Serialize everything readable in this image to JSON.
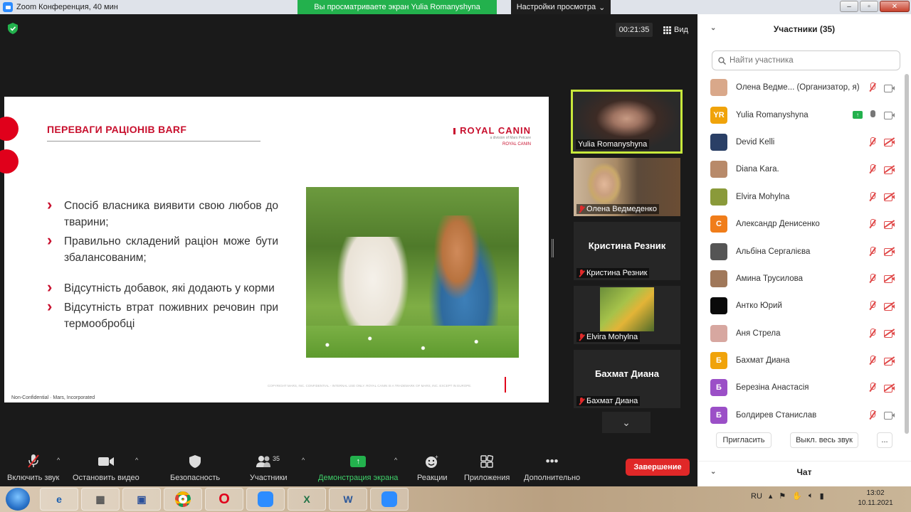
{
  "window": {
    "title": "Zoom Конференция, 40 мин",
    "share_banner": "Вы просматриваете экран Yulia Romanyshyna",
    "view_options": "Настройки просмотра"
  },
  "meeting": {
    "timer": "00:21:35",
    "view_label": "Вид"
  },
  "slide": {
    "title": "ПЕРЕВАГИ РАЦІОНІВ BARF",
    "logo_brand": "ROYAL CANIN",
    "logo_sub": "a division of Mars Petcare",
    "logo_crown": "ROYAL CANIN",
    "bullets": [
      "Спосіб власника виявити свою любов до тварини;",
      "Правильно складений раціон може бути збалансованим;",
      "Відсутність добавок, які додають у корми",
      "Відсутність втрат поживних речовин при термообробці"
    ],
    "copyright": "COPYRIGHT MARS, INC. CONFIDENTIAL - INTERNAL USE ONLY. ROYAL CANIN IS A TRADEMARK OF MARS, INC. EXCEPT IN EUROPE.",
    "footer": "Non-Confidential · Mars, Incorporated"
  },
  "gallery": [
    {
      "name": "Yulia Romanyshyna"
    },
    {
      "name": "Олена Ведмеденко"
    },
    {
      "name": "Кристина Резник",
      "center": "Кристина Резник"
    },
    {
      "name": "Elvira Mohylna"
    },
    {
      "name": "Бахмат Диана",
      "center": "Бахмат Диана"
    }
  ],
  "toolbar": {
    "unmute": "Включить звук",
    "stop_video": "Остановить видео",
    "security": "Безопасность",
    "participants": "Участники",
    "participants_count": "35",
    "share": "Демонстрация экрана",
    "reactions": "Реакции",
    "apps": "Приложения",
    "more": "Дополнительно",
    "end": "Завершение"
  },
  "panel": {
    "title": "Участники (35)",
    "search_placeholder": "Найти участника",
    "participants": [
      {
        "name": "Олена Ведме...  (Организатор, я)",
        "avatar_color": "#d9a88a",
        "avatar_text": ""
      },
      {
        "name": "Yulia Romanyshyna",
        "avatar_color": "#f0a30a",
        "avatar_text": "YR"
      },
      {
        "name": "Devid Kelli",
        "avatar_color": "#2a3f66",
        "avatar_text": ""
      },
      {
        "name": "Diana Kara.",
        "avatar_color": "#b88a6a",
        "avatar_text": ""
      },
      {
        "name": "Elvira Mohylna",
        "avatar_color": "#8a9a3a",
        "avatar_text": ""
      },
      {
        "name": "Александр Денисенко",
        "avatar_color": "#f07d1a",
        "avatar_text": "С"
      },
      {
        "name": "Альбіна Сергалієва",
        "avatar_color": "#555555",
        "avatar_text": ""
      },
      {
        "name": "Амина Трусилова",
        "avatar_color": "#a0785a",
        "avatar_text": ""
      },
      {
        "name": "Антко Юрий",
        "avatar_color": "#0a0a0a",
        "avatar_text": ""
      },
      {
        "name": "Аня Стрела",
        "avatar_color": "#d7a7a0",
        "avatar_text": ""
      },
      {
        "name": "Бахмат Диана",
        "avatar_color": "#f0a30a",
        "avatar_text": "Б"
      },
      {
        "name": "Березіна Анастасія",
        "avatar_color": "#9b4fc7",
        "avatar_text": "Б"
      },
      {
        "name": "Болдирев Станислав",
        "avatar_color": "#9b4fc7",
        "avatar_text": "Б"
      }
    ],
    "invite": "Пригласить",
    "mute_all": "Выкл. весь звук",
    "more": "...",
    "chat": "Чат"
  },
  "taskbar": {
    "lang": "RU",
    "time": "13:02",
    "date": "10.11.2021"
  }
}
